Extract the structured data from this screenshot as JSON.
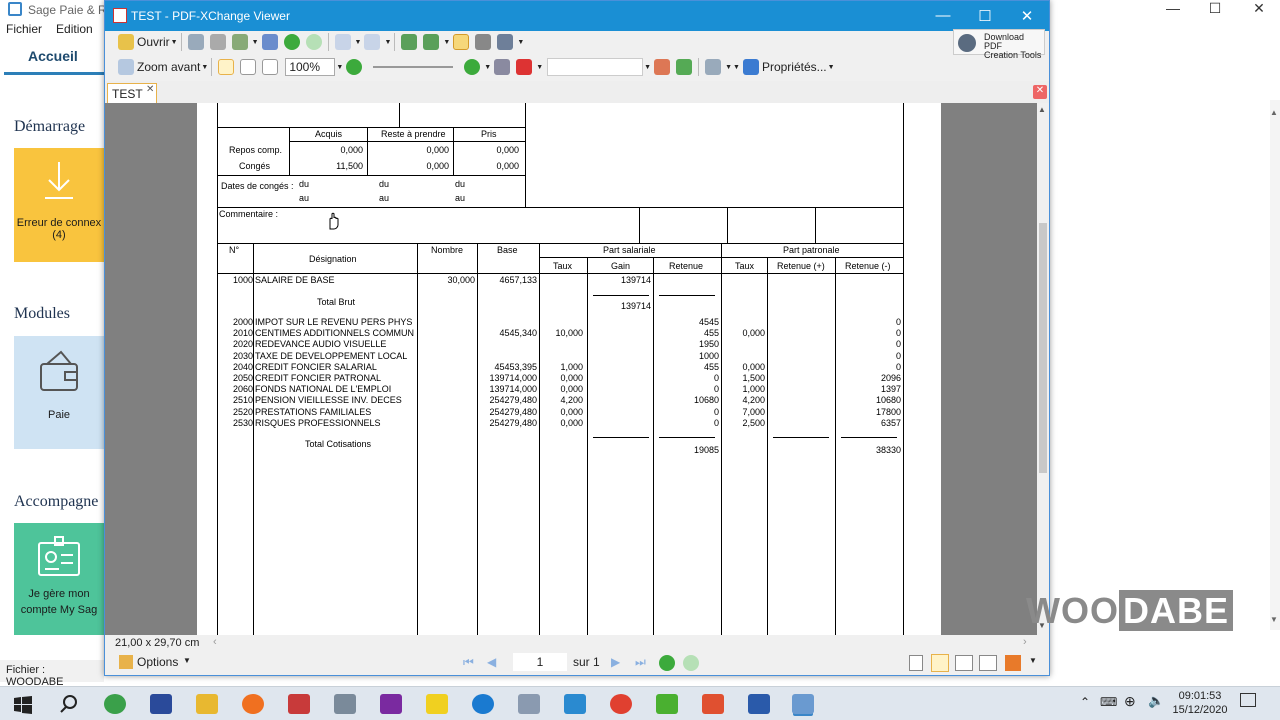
{
  "sage": {
    "title": "Sage Paie & RH",
    "menu": [
      "Fichier",
      "Edition"
    ],
    "tab": "Accueil",
    "sections": [
      "Démarrage",
      "Modules",
      "Accompagne"
    ],
    "tile_error": "Erreur de connex",
    "tile_error_count": "(4)",
    "tile_paie": "Paie",
    "tile_help_1": "Je gère mon",
    "tile_help_2": "compte My Sag",
    "status": "Fichier : WOODABE",
    "colors": {
      "tile_yellow": "#f9c43e",
      "tile_blue": "#cfe3f3",
      "tile_green": "#4ec49a"
    }
  },
  "pdf": {
    "title": "TEST - PDF-XChange Viewer",
    "toolbar": {
      "open": "Ouvrir",
      "zoom_in": "Zoom avant",
      "zoom_value": "100%",
      "properties": "Propriétés...",
      "download_1": "Download PDF",
      "download_2": "Creation Tools"
    },
    "tab": "TEST",
    "page_size": "21,00 x 29,70 cm",
    "options": "Options",
    "page_current": "1",
    "page_total": "sur 1"
  },
  "doc": {
    "leave": {
      "headers": [
        "Acquis",
        "Reste à prendre",
        "Pris"
      ],
      "rows": [
        {
          "label": "Repos comp.",
          "vals": [
            "0,000",
            "0,000",
            "0,000"
          ]
        },
        {
          "label": "Congés",
          "vals": [
            "11,500",
            "0,000",
            "0,000"
          ]
        }
      ],
      "dates_label": "Dates de congés :",
      "du": "du",
      "au": "au"
    },
    "comment_label": "Commentaire :",
    "headers": {
      "num": "N°",
      "designation": "Désignation",
      "nombre": "Nombre",
      "base": "Base",
      "part_salariale": "Part salariale",
      "part_patronale": "Part patronale",
      "taux": "Taux",
      "gain": "Gain",
      "retenue": "Retenue",
      "retenue_plus": "Retenue (+)",
      "retenue_minus": "Retenue (-)"
    },
    "salary_row": {
      "num": "1000",
      "label": "SALAIRE DE BASE",
      "nombre": "30,000",
      "base": "4657,133",
      "gain": "139714"
    },
    "total_brut_label": "Total Brut",
    "total_brut": "139714",
    "rows": [
      {
        "num": "2000",
        "label": "IMPOT SUR LE REVENU PERS PHYS",
        "base": "",
        "taux": "",
        "retenue": "4545",
        "taux_p": "",
        "ret_m": "0"
      },
      {
        "num": "2010",
        "label": "CENTIMES ADDITIONNELS COMMUN",
        "base": "4545,340",
        "taux": "10,000",
        "retenue": "455",
        "taux_p": "0,000",
        "ret_m": "0"
      },
      {
        "num": "2020",
        "label": "REDEVANCE AUDIO VISUELLE",
        "base": "",
        "taux": "",
        "retenue": "1950",
        "taux_p": "",
        "ret_m": "0"
      },
      {
        "num": "2030",
        "label": "TAXE DE DEVELOPPEMENT LOCAL",
        "base": "",
        "taux": "",
        "retenue": "1000",
        "taux_p": "",
        "ret_m": "0"
      },
      {
        "num": "2040",
        "label": "CREDIT FONCIER SALARIAL",
        "base": "45453,395",
        "taux": "1,000",
        "retenue": "455",
        "taux_p": "0,000",
        "ret_m": "0"
      },
      {
        "num": "2050",
        "label": "CREDIT FONCIER PATRONAL",
        "base": "139714,000",
        "taux": "0,000",
        "retenue": "0",
        "taux_p": "1,500",
        "ret_m": "2096"
      },
      {
        "num": "2060",
        "label": "FONDS NATIONAL DE L'EMPLOI",
        "base": "139714,000",
        "taux": "0,000",
        "retenue": "0",
        "taux_p": "1,000",
        "ret_m": "1397"
      },
      {
        "num": "2510",
        "label": "PENSION VIEILLESSE INV. DECES",
        "base": "254279,480",
        "taux": "4,200",
        "retenue": "10680",
        "taux_p": "4,200",
        "ret_m": "10680"
      },
      {
        "num": "2520",
        "label": "PRESTATIONS FAMILIALES",
        "base": "254279,480",
        "taux": "0,000",
        "retenue": "0",
        "taux_p": "7,000",
        "ret_m": "17800"
      },
      {
        "num": "2530",
        "label": "RISQUES PROFESSIONNELS",
        "base": "254279,480",
        "taux": "0,000",
        "retenue": "0",
        "taux_p": "2,500",
        "ret_m": "6357"
      }
    ],
    "total_cot_label": "Total Cotisations",
    "total_cot_retenue": "19085",
    "total_cot_patronale": "38330"
  },
  "watermark": {
    "a": "WOO",
    "b": "DABE"
  },
  "clock": {
    "time": "09:01:53",
    "date": "15/12/2020"
  }
}
